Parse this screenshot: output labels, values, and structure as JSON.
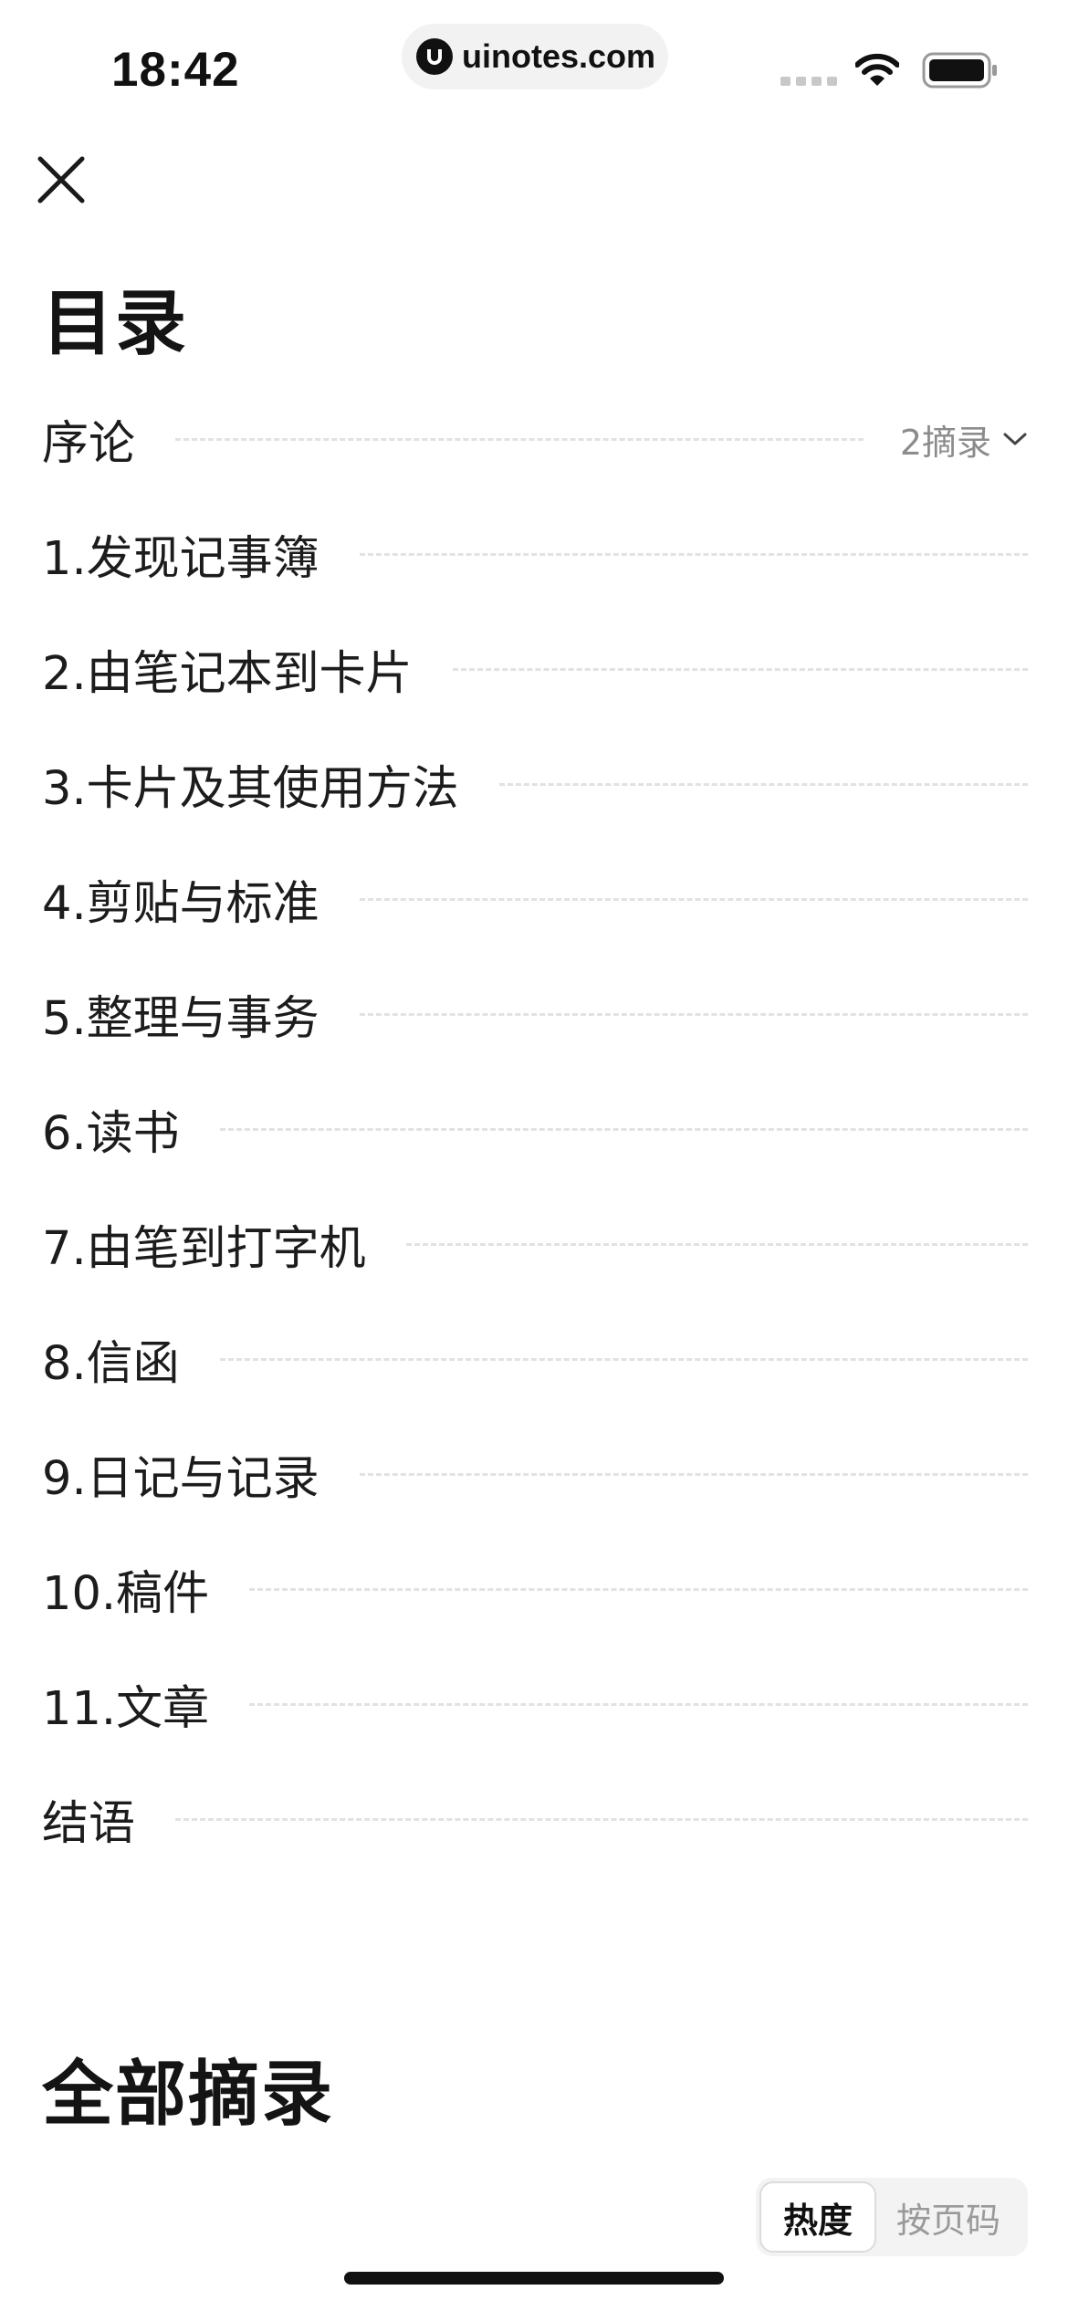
{
  "status_bar": {
    "time": "18:42",
    "url": "uinotes.com",
    "icons": [
      "signal-icon",
      "wifi-icon",
      "battery-icon"
    ]
  },
  "toolbar": {
    "close_icon": "close-icon"
  },
  "toc": {
    "title": "目录",
    "items": [
      {
        "label": "序论",
        "meta": "2摘录"
      },
      {
        "label": "1.发现记事簿"
      },
      {
        "label": "2.由笔记本到卡片"
      },
      {
        "label": "3.卡片及其使用方法"
      },
      {
        "label": "4.剪贴与标准"
      },
      {
        "label": "5.整理与事务"
      },
      {
        "label": "6.读书"
      },
      {
        "label": "7.由笔到打字机"
      },
      {
        "label": "8.信函"
      },
      {
        "label": "9.日记与记录"
      },
      {
        "label": "10.稿件"
      },
      {
        "label": "11.文章"
      },
      {
        "label": "结语"
      }
    ]
  },
  "excerpts": {
    "title": "全部摘录",
    "sort_options": [
      {
        "label": "热度",
        "active": true
      },
      {
        "label": "按页码",
        "active": false
      }
    ]
  },
  "colors": {
    "text": "#1c1c1c",
    "muted": "#8c8c8c",
    "leader": "#e2e2e2",
    "pill_bg": "#f2f2f2"
  }
}
